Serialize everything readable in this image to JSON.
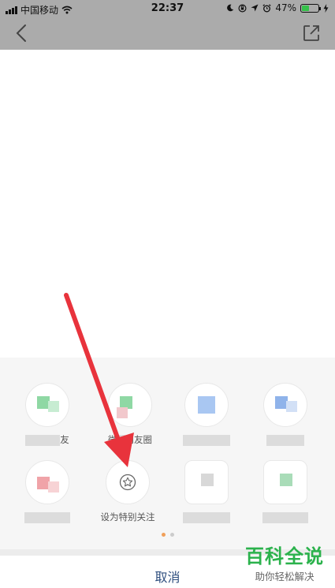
{
  "status_bar": {
    "carrier": "中国移动",
    "time": "22:37",
    "battery_percent": "47%",
    "battery_level": 0.47,
    "icons": [
      "signal-icon",
      "wifi-icon",
      "moon-icon",
      "lock-rotation-icon",
      "location-icon",
      "alarm-icon",
      "battery-icon",
      "charging-icon"
    ]
  },
  "nav": {
    "back_icon": "chevron-left-icon",
    "share_icon": "external-link-icon"
  },
  "share_sheet": {
    "row1": [
      {
        "label_visible": "",
        "label_suffix": "友",
        "accent": "#8fd8a4"
      },
      {
        "label_visible": "微",
        "label_suffix": "朋友圈",
        "accent": "#8fd8a4"
      },
      {
        "label_visible": "",
        "label_suffix": "",
        "accent": "#a9c7f2"
      },
      {
        "label_visible": "",
        "label_suffix": "",
        "accent": "#8fb3ea"
      }
    ],
    "row2": [
      {
        "label_visible": "",
        "accent": "#f0a3a8"
      },
      {
        "label_visible": "设为特别关注",
        "icon": "star-icon"
      },
      {
        "label_visible": "",
        "accent": "#d8d8d8"
      },
      {
        "label_visible": "",
        "accent": "#a9dcb8"
      }
    ],
    "page_dots": {
      "active_color": "#f0a05a",
      "inactive_color": "#cccccc"
    },
    "cancel_label": "取消"
  },
  "watermark": {
    "title": "百科全说",
    "subtitle": "助你轻松解决"
  },
  "colors": {
    "top_bar": "#ababab",
    "sheet_bg": "#f6f6f6",
    "arrow": "#e8333c",
    "watermark_green": "#2bb24c"
  }
}
